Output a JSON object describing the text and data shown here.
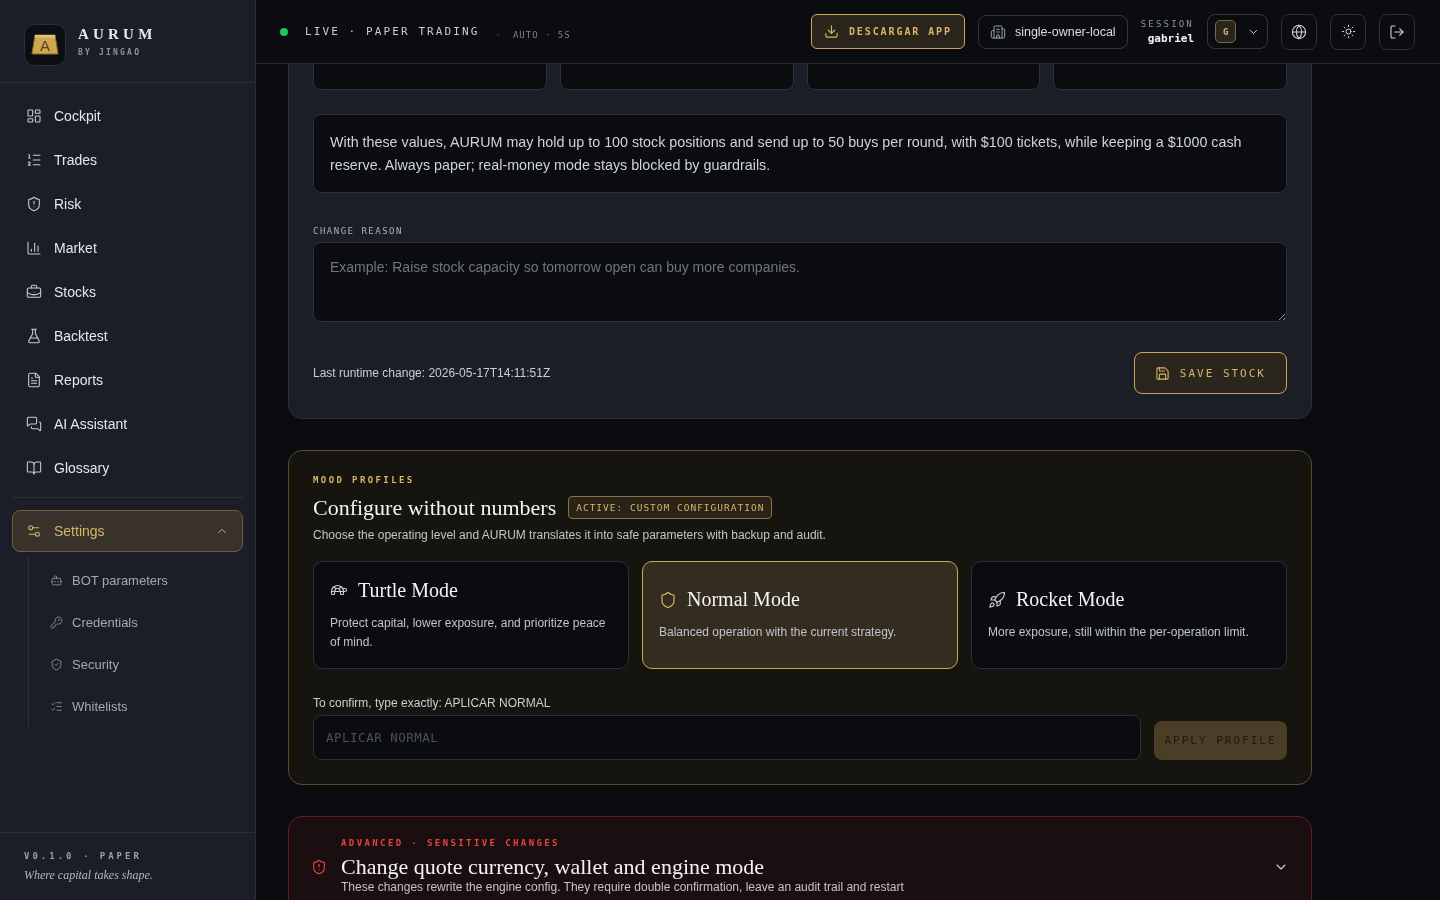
{
  "sidebar": {
    "brand": {
      "mark": "A",
      "name": "AURUM",
      "tagline": "BY JINGAO"
    },
    "nav": [
      {
        "label": "Cockpit",
        "selected": false
      },
      {
        "label": "Trades",
        "selected": false
      },
      {
        "label": "Risk",
        "selected": false
      },
      {
        "label": "Market",
        "selected": false
      },
      {
        "label": "Stocks",
        "selected": false
      },
      {
        "label": "Backtest",
        "selected": false
      },
      {
        "label": "Reports",
        "selected": false
      },
      {
        "label": "AI Assistant",
        "selected": false
      },
      {
        "label": "Glossary",
        "selected": false
      }
    ],
    "settings": {
      "label": "Settings",
      "selected": true,
      "expanded": true,
      "children": [
        {
          "label": "BOT parameters",
          "selected": false
        },
        {
          "label": "Credentials",
          "selected": false
        },
        {
          "label": "Security",
          "selected": false
        },
        {
          "label": "Whitelists",
          "selected": false
        }
      ]
    },
    "footer": {
      "version": "V0.1.0 · PAPER",
      "motto": "Where capital takes shape."
    }
  },
  "header": {
    "status": {
      "live": true,
      "label": "LIVE · PAPER TRADING",
      "separator": "·",
      "refresh": "AUTO · 5S"
    },
    "download_button": "DESCARGAR APP",
    "workspace_button": "single-owner-local",
    "session": {
      "label": "SESSION",
      "user": "gabriel",
      "avatar": "G"
    }
  },
  "capacity_card": {
    "summary": "With these values, AURUM may hold up to 100 stock positions and send up to 50 buys per round, with $100 tickets, while keeping a $1000 cash reserve. Always paper; real-money mode stays blocked by guardrails.",
    "reason": {
      "label": "CHANGE REASON",
      "placeholder": "Example: Raise stock capacity so tomorrow open can buy more companies."
    },
    "last_change": "Last runtime change: 2026-05-17T14:11:51Z",
    "save_button": "SAVE STOCK"
  },
  "mood_profiles": {
    "eyebrow": "MOOD PROFILES",
    "title": "Configure without numbers",
    "badge": "ACTIVE: CUSTOM CONFIGURATION",
    "description": "Choose the operating level and AURUM translates it into safe parameters with backup and audit.",
    "modes": [
      {
        "title": "Turtle Mode",
        "description": "Protect capital, lower exposure, and prioritize peace of mind.",
        "selected": false
      },
      {
        "title": "Normal Mode",
        "description": "Balanced operation with the current strategy.",
        "selected": true
      },
      {
        "title": "Rocket Mode",
        "description": "More exposure, still within the per-operation limit.",
        "selected": false
      }
    ],
    "confirm": {
      "label": "To confirm, type exactly: APLICAR NORMAL",
      "placeholder": "APLICAR NORMAL"
    },
    "apply_button": {
      "label": "APPLY PROFILE",
      "disabled": true
    }
  },
  "advanced": {
    "eyebrow": "ADVANCED · SENSITIVE CHANGES",
    "title": "Change quote currency, wallet and engine mode",
    "description": "These changes rewrite the engine config. They require double confirmation, leave an audit trail and restart",
    "expanded": false
  }
}
